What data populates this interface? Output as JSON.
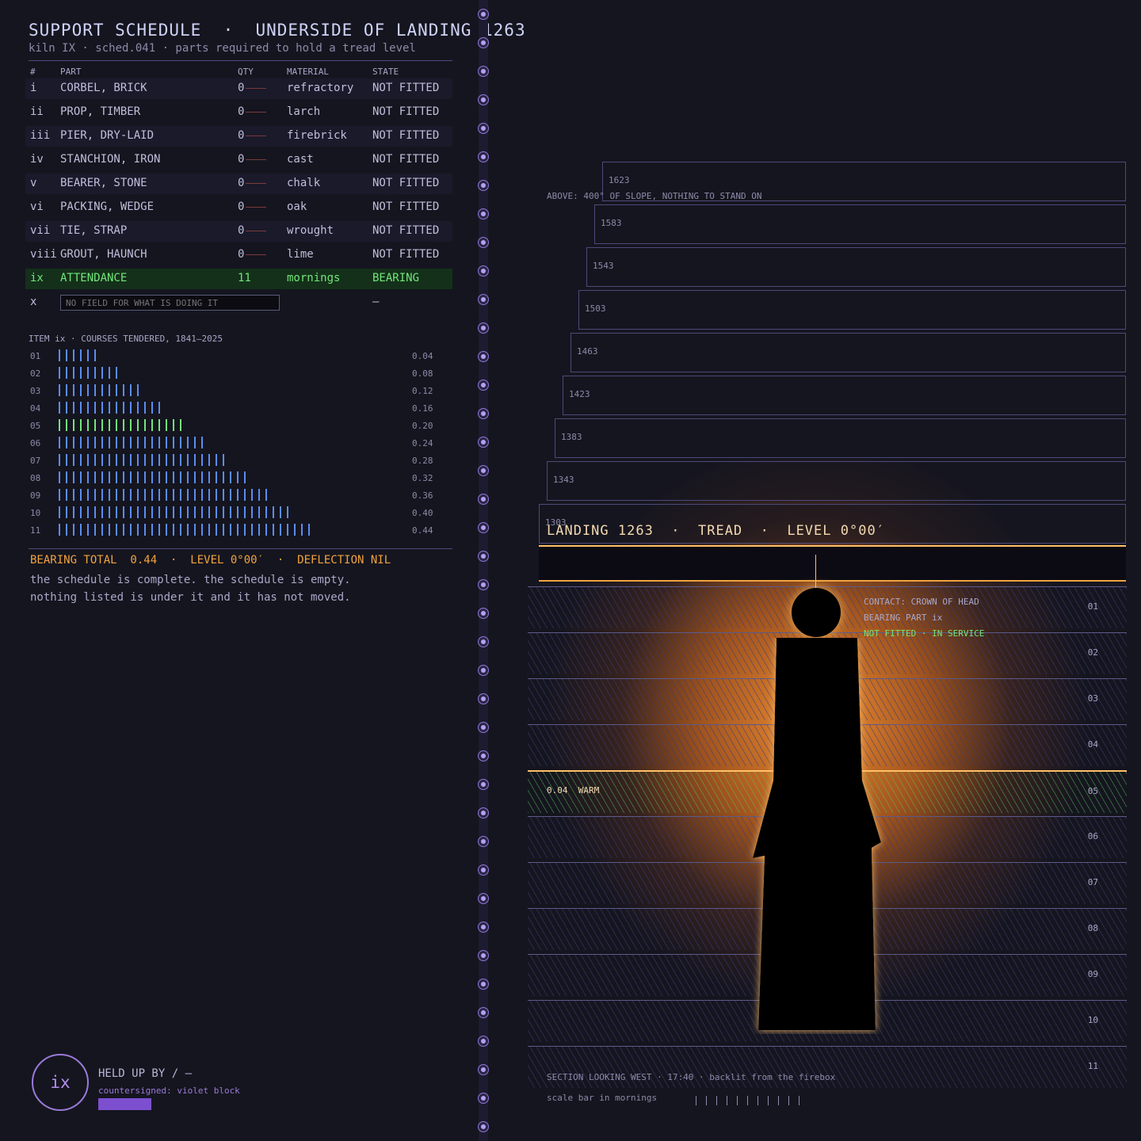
{
  "header": {
    "title": "SUPPORT SCHEDULE  ·  UNDERSIDE OF LANDING 1263",
    "subtitle": "kiln IX · sched.041 · parts required to hold a tread level"
  },
  "table": {
    "columns": [
      "#",
      "PART",
      "QTY",
      "MATERIAL",
      "STATE"
    ],
    "rows": [
      {
        "num": "i",
        "part": "CORBEL, BRICK",
        "qty": "0",
        "material": "refractory",
        "state": "NOT FITTED"
      },
      {
        "num": "ii",
        "part": "PROP, TIMBER",
        "qty": "0",
        "material": "larch",
        "state": "NOT FITTED"
      },
      {
        "num": "iii",
        "part": "PIER, DRY-LAID",
        "qty": "0",
        "material": "firebrick",
        "state": "NOT FITTED"
      },
      {
        "num": "iv",
        "part": "STANCHION, IRON",
        "qty": "0",
        "material": "cast",
        "state": "NOT FITTED"
      },
      {
        "num": "v",
        "part": "BEARER, STONE",
        "qty": "0",
        "material": "chalk",
        "state": "NOT FITTED"
      },
      {
        "num": "vi",
        "part": "PACKING, WEDGE",
        "qty": "0",
        "material": "oak",
        "state": "NOT FITTED"
      },
      {
        "num": "vii",
        "part": "TIE, STRAP",
        "qty": "0",
        "material": "wrought",
        "state": "NOT FITTED"
      },
      {
        "num": "viii",
        "part": "GROUT, HAUNCH",
        "qty": "0",
        "material": "lime",
        "state": "NOT FITTED"
      },
      {
        "num": "ix",
        "part": "ATTENDANCE",
        "qty": "11",
        "material": "mornings",
        "state": "BEARING"
      }
    ],
    "last_row": {
      "num": "x",
      "placeholder": "NO FIELD FOR WHAT IS DOING IT",
      "state": "—"
    }
  },
  "tally": {
    "title": "ITEM ix · COURSES TENDERED, 1841–2025",
    "rows": [
      {
        "n": "01",
        "value": "0.04",
        "marks": 6
      },
      {
        "n": "02",
        "value": "0.08",
        "marks": 9
      },
      {
        "n": "03",
        "value": "0.12",
        "marks": 12
      },
      {
        "n": "04",
        "value": "0.16",
        "marks": 15
      },
      {
        "n": "05",
        "value": "0.20",
        "marks": 18,
        "hot": true
      },
      {
        "n": "06",
        "value": "0.24",
        "marks": 21
      },
      {
        "n": "07",
        "value": "0.28",
        "marks": 24
      },
      {
        "n": "08",
        "value": "0.32",
        "marks": 27
      },
      {
        "n": "09",
        "value": "0.36",
        "marks": 30
      },
      {
        "n": "10",
        "value": "0.40",
        "marks": 33
      },
      {
        "n": "11",
        "value": "0.44",
        "marks": 36
      }
    ]
  },
  "summary": {
    "total": "BEARING TOTAL  0.44  ·  LEVEL 0°00′  ·  DEFLECTION NIL",
    "line1": "the schedule is complete. the schedule is empty.",
    "line2": "nothing listed is under it and it has not moved."
  },
  "seal": {
    "mark": "ix",
    "held_by": "HELD UP BY / —",
    "countersigned": "countersigned: violet block",
    "violet": "#7c4fd0"
  },
  "drawing": {
    "flights": [
      "1623",
      "1583",
      "1543",
      "1503",
      "1463",
      "1423",
      "1383",
      "1343",
      "1303"
    ],
    "above_note": "ABOVE: 400° OF SLOPE, NOTHING TO STAND ON",
    "landing_label": "LANDING 1263  ·  TREAD  ·  LEVEL 0°00′",
    "courses": [
      "01",
      "02",
      "03",
      "04",
      "05",
      "06",
      "07",
      "08",
      "09",
      "10",
      "11"
    ],
    "warm_note": "0.04  WARM",
    "contact": "CONTACT: CROWN OF HEAD",
    "bearing_part": "BEARING PART ix",
    "status": "NOT FITTED · IN SERVICE",
    "section": "SECTION LOOKING WEST · 17:40 · backlit from the firebox",
    "scale_label": "scale bar in mornings",
    "scale_ticks": 11
  },
  "colors": {
    "background": "#15151f",
    "accent_orange": "#f0a33e",
    "bearing_green": "#72e67a",
    "tally_blue": "#5b8df0",
    "violet": "#9a7ad8"
  }
}
